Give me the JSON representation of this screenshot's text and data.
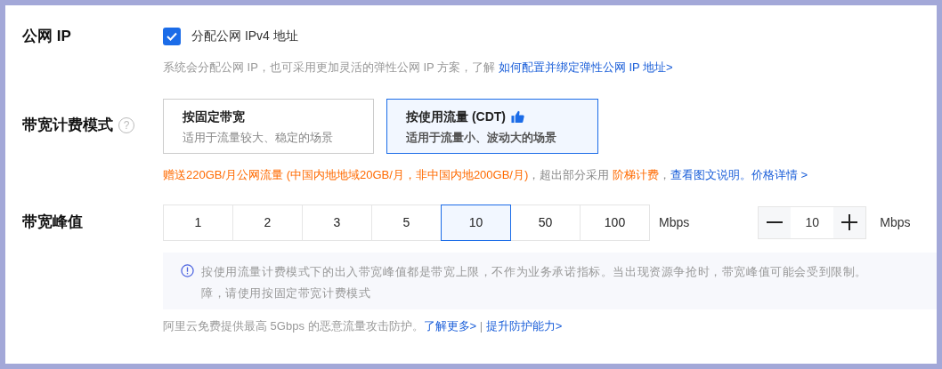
{
  "public_ip": {
    "label": "公网 IP",
    "checkbox": {
      "label": "分配公网 IPv4 地址",
      "checked": true
    },
    "hint": [
      {
        "kind": "text",
        "text": "系统会分配公网 IP，也可采用更加灵活的弹性公网 IP 方案，了解 "
      },
      {
        "kind": "link",
        "text": "如何配置并绑定弹性公网 IP 地址>"
      }
    ]
  },
  "billing": {
    "label": "带宽计费模式",
    "help_icon": "?",
    "options": [
      {
        "title": "按固定带宽",
        "subtitle": "适用于流量较大、稳定的场景",
        "selected": false,
        "recommended": false
      },
      {
        "title": "按使用流量 (CDT)",
        "subtitle": "适用于流量小、波动大的场景",
        "selected": true,
        "recommended": true
      }
    ],
    "note": [
      {
        "kind": "highlight",
        "text": "赠送220GB/月公网流量 (中国内地地域20GB/月，非中国内地200GB/月)"
      },
      {
        "kind": "text",
        "text": "，超出部分采用 "
      },
      {
        "kind": "highlight",
        "text": "阶梯计费"
      },
      {
        "kind": "link",
        "lead": "，",
        "text": "查看图文说明。"
      },
      {
        "kind": "link",
        "text": "价格详情 >"
      }
    ]
  },
  "bandwidth": {
    "label": "带宽峰值",
    "options": [
      {
        "text": "1",
        "selected": false
      },
      {
        "text": "2",
        "selected": false
      },
      {
        "text": "3",
        "selected": false
      },
      {
        "text": "5",
        "selected": false
      },
      {
        "text": "10",
        "selected": true
      },
      {
        "text": "50",
        "selected": false
      },
      {
        "text": "100",
        "selected": false
      }
    ],
    "unit": "Mbps",
    "stepper": {
      "value": "10",
      "unit": "Mbps"
    },
    "info_lines": [
      "按使用流量计费模式下的出入带宽峰值都是带宽上限，不作为业务承诺指标。当出现资源争抢时，带宽峰值可能会受到限制。",
      "障，请使用按固定带宽计费模式"
    ],
    "footer": [
      {
        "kind": "text",
        "text": "阿里云免费提供最高 5Gbps 的恶意流量攻击防护。"
      },
      {
        "kind": "link",
        "text": "了解更多>"
      },
      {
        "kind": "text",
        "text": " | "
      },
      {
        "kind": "link",
        "text": "提升防护能力>"
      }
    ]
  }
}
